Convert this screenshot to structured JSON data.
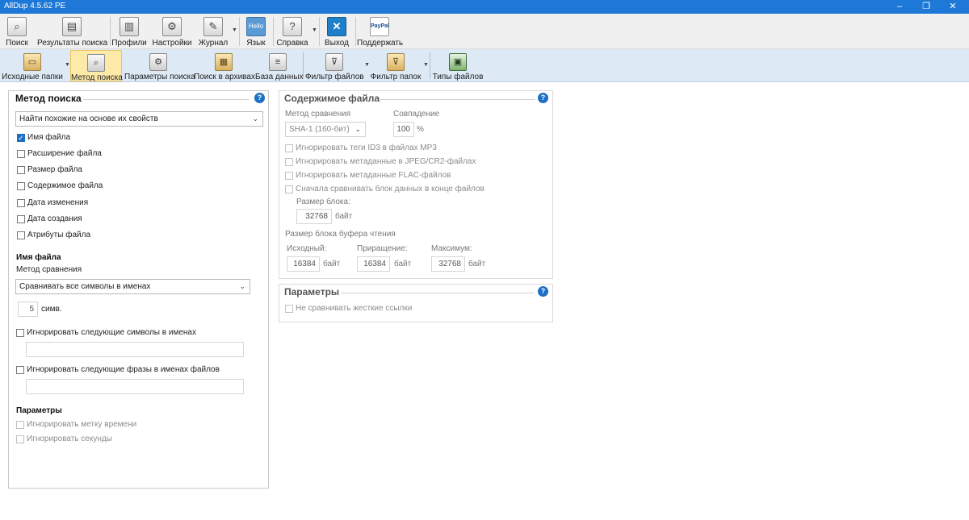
{
  "window": {
    "title": "AllDup 4.5.62 PE",
    "controls": [
      "–",
      "❐",
      "✕"
    ]
  },
  "toolbar_main": {
    "items": [
      {
        "label": "Поиск",
        "icon": "search-icon",
        "glyph": "⌕"
      },
      {
        "label": "Результаты поиска",
        "icon": "results-icon",
        "glyph": "▤"
      },
      {
        "label": "Профили",
        "icon": "profiles-icon",
        "glyph": "▥"
      },
      {
        "label": "Настройки",
        "icon": "settings-icon",
        "glyph": "⚙"
      },
      {
        "label": "Журнал",
        "icon": "log-icon",
        "glyph": "✎"
      },
      {
        "label": "Язык",
        "icon": "language-icon",
        "glyph": "Hello"
      },
      {
        "label": "Справка",
        "icon": "help-icon",
        "glyph": "?"
      },
      {
        "label": "Выход",
        "icon": "exit-icon",
        "glyph": "✕"
      },
      {
        "label": "Поддержать",
        "icon": "paypal-icon",
        "glyph": "PayPal"
      }
    ]
  },
  "toolbar_secondary": {
    "items": [
      {
        "label": "Исходные папки",
        "icon": "folder-icon",
        "glyph": "▭"
      },
      {
        "label": "Метод поиска",
        "icon": "search-method-icon",
        "glyph": "⌕",
        "active": true
      },
      {
        "label": "Параметры поиска",
        "icon": "search-params-icon",
        "glyph": "⚙"
      },
      {
        "label": "Поиск в архивах",
        "icon": "archive-icon",
        "glyph": "▦"
      },
      {
        "label": "База данных",
        "icon": "database-icon",
        "glyph": "≡"
      },
      {
        "label": "Фильтр файлов",
        "icon": "file-filter-icon",
        "glyph": "⊽"
      },
      {
        "label": "Фильтр папок",
        "icon": "folder-filter-icon",
        "glyph": "⊽"
      },
      {
        "label": "Типы файлов",
        "icon": "file-types-icon",
        "glyph": "▣"
      }
    ]
  },
  "search_method": {
    "title": "Метод поиска",
    "mode": "Найти похожие на основе их свойств",
    "properties": [
      {
        "label": "Имя файла",
        "checked": true
      },
      {
        "label": "Расширение файла",
        "checked": false
      },
      {
        "label": "Размер файла",
        "checked": false
      },
      {
        "label": "Содержимое файла",
        "checked": false
      },
      {
        "label": "Дата изменения",
        "checked": false
      },
      {
        "label": "Дата создания",
        "checked": false
      },
      {
        "label": "Атрибуты файла",
        "checked": false
      }
    ],
    "filename_section": "Имя файла",
    "compare_method_label": "Метод сравнения",
    "compare_method": "Сравнивать все символы в именах",
    "chars_value": "5",
    "chars_unit": "симв.",
    "ignore_chars_label": "Игнорировать следующие символы в именах",
    "ignore_chars_value": "",
    "ignore_phrases_label": "Игнорировать следующие фразы в именах файлов",
    "ignore_phrases_value": "",
    "params_title": "Параметры",
    "ignore_timestamp": "Игнорировать метку времени",
    "ignore_seconds": "Игнорировать секунды"
  },
  "file_content": {
    "title": "Содержимое файла",
    "compare_method_label": "Метод сравнения",
    "compare_method": "SHA-1 (160-бит)",
    "match_label": "Совпадение",
    "match_value": "100",
    "match_unit": "%",
    "ignore_id3": "Игнорировать теги ID3 в файлах MP3",
    "ignore_jpeg": "Игнорировать метаданные в JPEG/CR2-файлах",
    "ignore_flac": "Игнорировать метаданные FLAC-файлов",
    "compare_end": "Сначала сравнивать блок данных в конце файлов",
    "block_size_label": "Размер блока:",
    "block_size_value": "32768",
    "unit_bytes": "байт",
    "buffer_label": "Размер блока буфера чтения",
    "initial_label": "Исходный:",
    "initial_value": "16384",
    "increment_label": "Приращение:",
    "increment_value": "16384",
    "max_label": "Максимум:",
    "max_value": "32768"
  },
  "params_right": {
    "title": "Параметры",
    "no_hardlinks": "Не сравнивать жесткие ссылки"
  },
  "help_glyph": "?"
}
